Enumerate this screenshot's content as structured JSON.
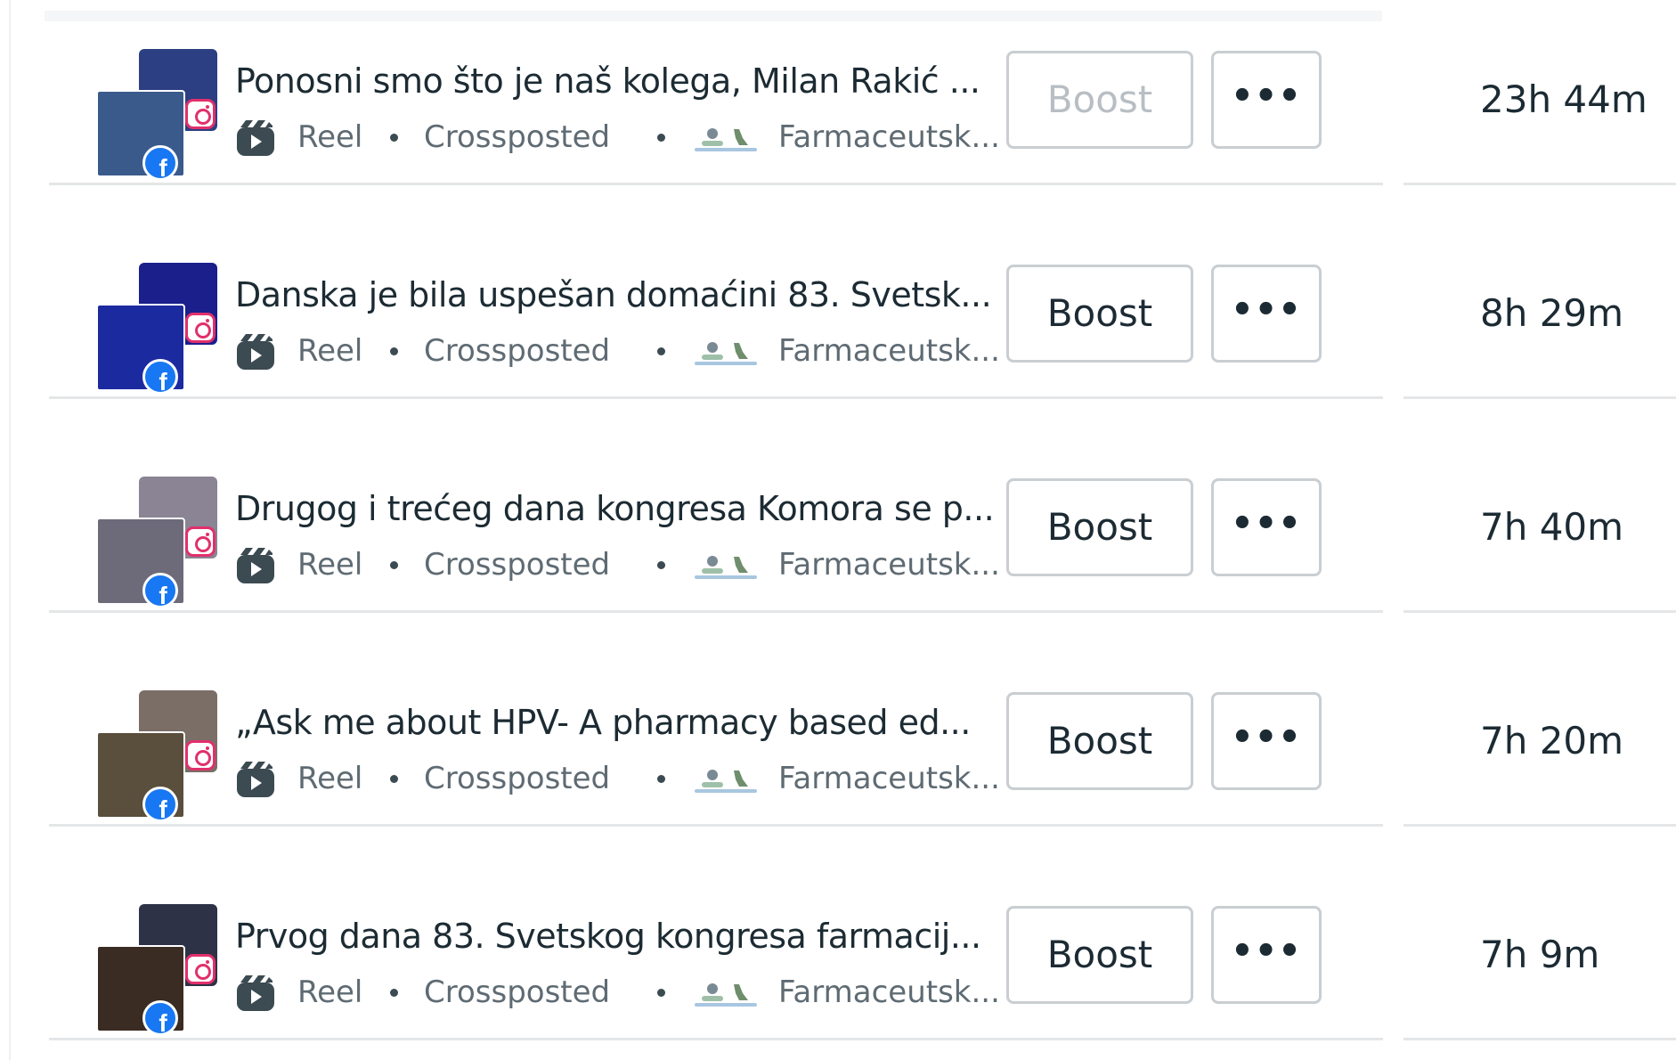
{
  "posts": [
    {
      "title": "Ponosni smo što je naš kolega, Milan Rakić ...",
      "type": "Reel",
      "status": "Crossposted",
      "page": "Farmaceutsk...",
      "boost_label": "Boost",
      "boost_enabled": false,
      "more_label": "•••",
      "duration": "23h 44m",
      "thumb_back_color": "#2c3f82",
      "thumb_front_color": "#3a5a8c"
    },
    {
      "title": "Danska je bila uspešan domaćini 83. Svetsk...",
      "type": "Reel",
      "status": "Crossposted",
      "page": "Farmaceutsk...",
      "boost_label": "Boost",
      "boost_enabled": true,
      "more_label": "•••",
      "duration": "8h 29m",
      "thumb_back_color": "#1a1f8c",
      "thumb_front_color": "#1c2aa0"
    },
    {
      "title": "Drugog i trećeg dana kongresa Komora se p...",
      "type": "Reel",
      "status": "Crossposted",
      "page": "Farmaceutsk...",
      "boost_label": "Boost",
      "boost_enabled": true,
      "more_label": "•••",
      "duration": "7h 40m",
      "thumb_back_color": "#8a8494",
      "thumb_front_color": "#6d6a7a"
    },
    {
      "title": "„Ask me about HPV- A pharmacy based ed...",
      "type": "Reel",
      "status": "Crossposted",
      "page": "Farmaceutsk...",
      "boost_label": "Boost",
      "boost_enabled": true,
      "more_label": "•••",
      "duration": "7h 20m",
      "thumb_back_color": "#7a6e66",
      "thumb_front_color": "#5a4e3c"
    },
    {
      "title": "Prvog dana 83. Svetskog kongresa farmacij...",
      "type": "Reel",
      "status": "Crossposted",
      "page": "Farmaceutsk...",
      "boost_label": "Boost",
      "boost_enabled": true,
      "more_label": "•••",
      "duration": "7h 9m",
      "thumb_back_color": "#2e3246",
      "thumb_front_color": "#3a2c22"
    }
  ],
  "icons": {
    "reel": "reel-icon",
    "people": "people-icon",
    "instagram": "instagram-icon",
    "facebook": "facebook-icon",
    "more": "more-options-icon"
  },
  "colors": {
    "facebook_blue": "#1877f2",
    "instagram_pink": "#e1306c"
  }
}
